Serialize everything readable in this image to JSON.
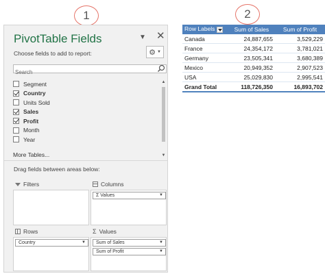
{
  "callouts": {
    "one": "1",
    "two": "2"
  },
  "panel": {
    "title": "PivotTable Fields",
    "choose_label": "Choose fields to add to report:",
    "search_placeholder": "Search",
    "fields": [
      {
        "label": "Segment",
        "checked": false,
        "bold": false
      },
      {
        "label": "Country",
        "checked": true,
        "bold": true
      },
      {
        "label": "Units Sold",
        "checked": false,
        "bold": false
      },
      {
        "label": "Sales",
        "checked": true,
        "bold": true
      },
      {
        "label": "Profit",
        "checked": true,
        "bold": true
      },
      {
        "label": "Month",
        "checked": false,
        "bold": false
      },
      {
        "label": "Year",
        "checked": false,
        "bold": false
      }
    ],
    "more_tables": "More Tables...",
    "drag_label": "Drag fields between areas below:",
    "areas": {
      "filters": {
        "label": "Filters",
        "items": []
      },
      "columns": {
        "label": "Columns",
        "items": [
          "Σ Values"
        ]
      },
      "rows": {
        "label": "Rows",
        "items": [
          "Country"
        ]
      },
      "values": {
        "label": "Values",
        "items": [
          "Sum of  Sales",
          "Sum of Profit"
        ]
      }
    },
    "icons": {
      "dropdown": "▼",
      "close": "✕",
      "gear": "⚙",
      "scroll_up": "▲",
      "scroll_down": "▼",
      "sigma": "Σ"
    }
  },
  "pivot": {
    "headers": [
      "Row Labels",
      "Sum of  Sales",
      "Sum of Profit"
    ],
    "rows": [
      [
        "Canada",
        "24,887,655",
        "3,529,229"
      ],
      [
        "France",
        "24,354,172",
        "3,781,021"
      ],
      [
        "Germany",
        "23,505,341",
        "3,680,389"
      ],
      [
        "Mexico",
        "20,949,352",
        "2,907,523"
      ],
      [
        "USA",
        "25,029,830",
        "2,995,541"
      ]
    ],
    "total": [
      "Grand Total",
      "118,726,350",
      "16,893,702"
    ],
    "header_color": "#4f81bd"
  }
}
